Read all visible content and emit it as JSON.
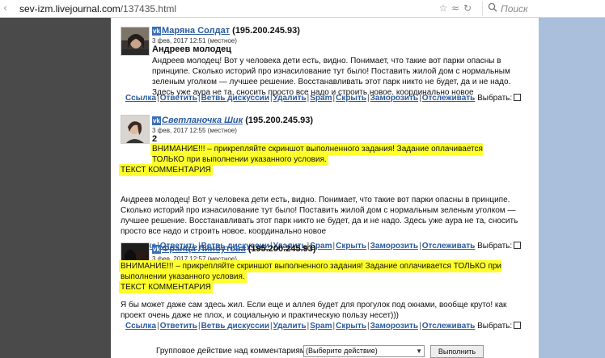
{
  "browser": {
    "url_host": "sev-izm.livejournal.com",
    "url_path": "/137435.html",
    "search_placeholder": "Поиск",
    "icons": [
      "back-arrow-icon",
      "star-icon",
      "rss-icon",
      "reload-icon",
      "search-icon"
    ]
  },
  "colors": {
    "left_bar": "#4a4a4a",
    "right_bar": "#a9bfdc",
    "link": "#2b5ba0",
    "highlight": "#ffff2b"
  },
  "comments": [
    {
      "username": "Маряна Солдат",
      "ip": "(195.200.245.93)",
      "date": "3 фев, 2017 12:51 (местное)",
      "subject": "Андреев молодец",
      "text": "Андреев молодец! Вот у человека дети есть, видно. Понимает, что такие вот парки опасны в принципе. Сколько историй про изнасилование тут было! Поставить жилой дом с нормальным зеленым уголком — лучшее решение. Восстанавливать этот парк никто не будет, да и не надо. Здесь уже аура не та, сносить просто все надо и строить новое. координально новое"
    },
    {
      "username": "Светланочка Шик",
      "ip": "(195.200.245.93)",
      "date": "3 фев, 2017 12:55 (местное)",
      "subject": "2",
      "highlight_text": "ВНИМАНИЕ!!! – прикрепляйте скриншот выполненного задания! Задание оплачивается ТОЛЬКО при выполнении указанного условия.",
      "highlight_comment": "ТЕКСТ КОММЕНТАРИЯ",
      "text": "Андреев молодец! Вот у человека дети есть, видно. Понимает, что такие вот парки опасны в принципе. Сколько историй про изнасилование тут было! Поставить жилой дом с нормальным зеленым уголком — лучшее решение. Восстанавливать этот парк никто не будет, да и не надо. Здесь уже аура не та, сносить просто все надо и строить новое. координально новое"
    },
    {
      "username": "Франца Линбутова",
      "ip": "(195.200.245.93)",
      "date": "3 фев, 2017 12:57 (местное)",
      "highlight_text": "ВНИМАНИЕ!!! – прикрепляйте скриншот выполненного задания! Задание оплачивается ТОЛЬКО при выполнении указанного условия.",
      "highlight_comment": "ТЕКСТ КОММЕНТАРИЯ",
      "text": "Я бы может даже сам здесь жил. Если еще и аллея будет для прогулок под окнами, вообще круто! как проект очень даже не плох, и социальную и практическую пользу несет)))"
    }
  ],
  "actions": {
    "link": "Ссылка",
    "reply": "Ответить",
    "thread": "Ветвь дискуссии",
    "delete": "Удалить",
    "spam": "Spam",
    "hide": "Скрыть",
    "freeze": "Заморозить",
    "track": "Отслеживать",
    "select": "Выбрать:"
  },
  "group_action": {
    "label": "Групповое действие над комментариями:",
    "select_value": "(Выберите действие)",
    "button": "Выполнить"
  }
}
